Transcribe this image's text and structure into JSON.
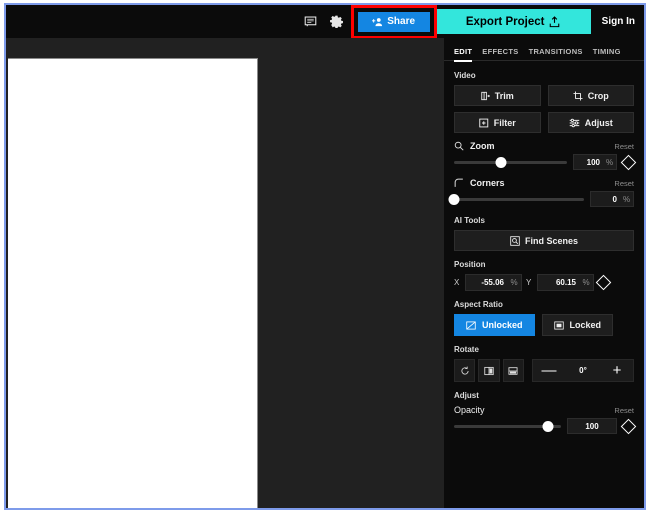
{
  "topbar": {
    "comment_icon": "comment-icon",
    "settings_icon": "gear-icon",
    "share_label": "Share",
    "share_icon": "add-person-icon",
    "export_label": "Export Project",
    "export_icon": "upload-icon",
    "signin_label": "Sign In",
    "share_accent": "#1486e2",
    "export_accent": "#33e6dc",
    "highlight_color": "#ff0000"
  },
  "tabs": [
    {
      "label": "EDIT",
      "active": true
    },
    {
      "label": "EFFECTS",
      "active": false
    },
    {
      "label": "TRANSITIONS",
      "active": false
    },
    {
      "label": "TIMING",
      "active": false
    }
  ],
  "video": {
    "section_label": "Video",
    "buttons": [
      {
        "label": "Trim",
        "icon": "trim-icon"
      },
      {
        "label": "Crop",
        "icon": "crop-icon"
      },
      {
        "label": "Filter",
        "icon": "filter-icon"
      },
      {
        "label": "Adjust",
        "icon": "adjust-icon"
      }
    ]
  },
  "zoom": {
    "label": "Zoom",
    "icon": "magnifier-icon",
    "reset_label": "Reset",
    "value": "100",
    "unit": "%",
    "slider_percent": 42
  },
  "corners": {
    "label": "Corners",
    "icon": "corner-radius-icon",
    "reset_label": "Reset",
    "value": "0",
    "unit": "%",
    "slider_percent": 0
  },
  "ai_tools": {
    "section_label": "AI Tools",
    "find_scenes_label": "Find Scenes",
    "find_scenes_icon": "find-scenes-icon"
  },
  "position": {
    "section_label": "Position",
    "x_label": "X",
    "x_value": "-55.06",
    "x_unit": "%",
    "y_label": "Y",
    "y_value": "60.15",
    "y_unit": "%"
  },
  "aspect_ratio": {
    "section_label": "Aspect Ratio",
    "unlocked_label": "Unlocked",
    "unlocked_icon": "unlocked-ratio-icon",
    "locked_label": "Locked",
    "locked_icon": "locked-ratio-icon",
    "active": "Unlocked"
  },
  "rotate": {
    "section_label": "Rotate",
    "buttons": [
      {
        "icon": "rotate-ccw-icon"
      },
      {
        "icon": "flip-horizontal-icon"
      },
      {
        "icon": "flip-vertical-icon"
      }
    ],
    "minus_label": "—",
    "angle_value": "0°",
    "plus_label": "+"
  },
  "adjust": {
    "section_label": "Adjust",
    "opacity_label": "Opacity",
    "reset_label": "Reset",
    "opacity_value": "100",
    "slider_percent": 88
  }
}
